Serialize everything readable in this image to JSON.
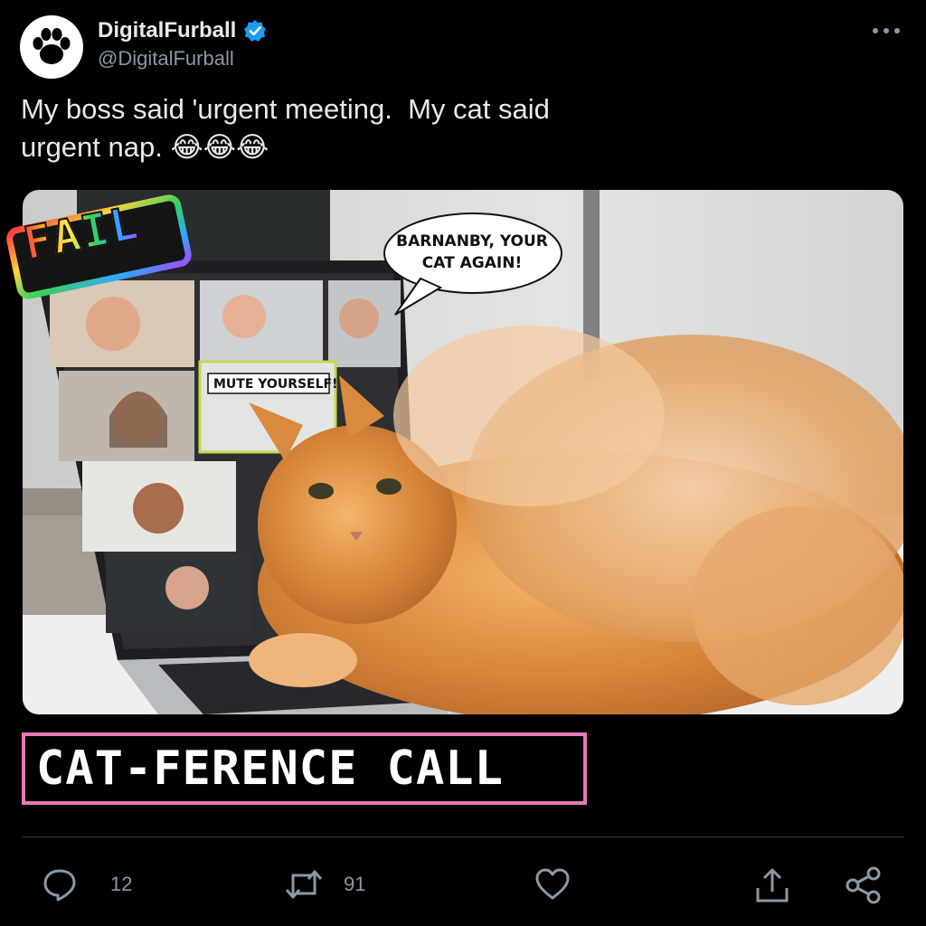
{
  "header": {
    "display_name": "DigitalFurball",
    "handle": "@DigitalFurball",
    "verified": true,
    "avatar_icon": "paw-icon",
    "more_icon": "more-icon"
  },
  "tweet": {
    "text": "My boss said 'urgent meeting.  My cat said\nurgent nap. ",
    "emojis": [
      "😂",
      "😂",
      "😂"
    ]
  },
  "media": {
    "fail_sticker": "FAIL",
    "speech_bubble": "BARNANBY, YOUR\nCAT AGAIN!",
    "mute_label": "MUTE YOURSELF!",
    "caption": "CAT-FERENCE CALL"
  },
  "actions": {
    "reply_count": "12",
    "retweet_count": "91",
    "icons": [
      "reply-icon",
      "retweet-icon",
      "like-icon",
      "share-icon",
      "network-share-icon"
    ]
  },
  "colors": {
    "background": "#000000",
    "text": "#e7e9ea",
    "muted": "#8b98a5",
    "verified": "#1d9bf0",
    "caption_border": "#e779b6"
  }
}
